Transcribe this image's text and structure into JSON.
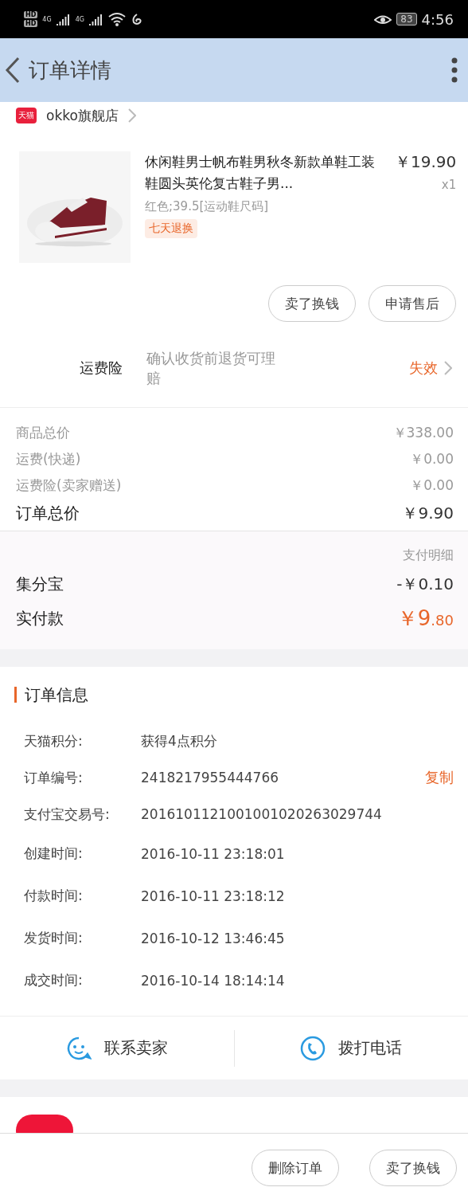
{
  "status_bar": {
    "sim_labels": [
      "HD",
      "HD"
    ],
    "network": [
      "4G",
      "4G"
    ],
    "battery": "83",
    "time": "4:56"
  },
  "header": {
    "title": "订单详情"
  },
  "store": {
    "badge": "天猫",
    "name": "okko旗舰店"
  },
  "product": {
    "kind": "picture",
    "title": "休闲鞋男士帆布鞋男秋冬新款单鞋工装鞋圆头英伦复古鞋子男...",
    "price": "￥19.90",
    "quantity": "x1",
    "spec": "红色;39.5[运动鞋尺码]",
    "tag": "七天退换"
  },
  "item_buttons": [
    "卖了换钱",
    "申请售后"
  ],
  "insurance": {
    "label": "运费险",
    "description": "确认收货前退货可理赔",
    "status": "失效"
  },
  "price_lines": [
    {
      "label": "商品总价",
      "value": "￥338.00",
      "kind": "minor"
    },
    {
      "label": "运费(快递)",
      "value": "￥0.00",
      "kind": "minor"
    },
    {
      "label": "运费险(卖家赠送)",
      "value": "￥0.00",
      "kind": "minor"
    },
    {
      "label": "订单总价",
      "value": "￥9.90",
      "kind": "major"
    }
  ],
  "payment": {
    "detail_link": "支付明细",
    "lines": [
      {
        "label": "集分宝",
        "value": "-￥0.10",
        "kind": "discount"
      },
      {
        "label": "实付款",
        "value_main": "￥9",
        "value_cents": ".80",
        "kind": "total"
      }
    ]
  },
  "order_info": {
    "title": "订单信息",
    "rows": [
      {
        "label": "天猫积分:",
        "value": "获得4点积分"
      },
      {
        "label": "订单编号:",
        "value": "2418217955444766",
        "action": "复制"
      },
      {
        "label": "支付宝交易号:",
        "value": "2016101121001001020263029744"
      },
      {
        "label": "创建时间:",
        "value": "2016-10-11 23:18:01"
      },
      {
        "label": "付款时间:",
        "value": "2016-10-11 23:18:12"
      },
      {
        "label": "发货时间:",
        "value": "2016-10-12 13:46:45"
      },
      {
        "label": "成交时间:",
        "value": "2016-10-14 18:14:14"
      }
    ]
  },
  "contact": [
    {
      "label": "联系卖家",
      "kind": "chat"
    },
    {
      "label": "拨打电话",
      "kind": "phone"
    }
  ],
  "bottom_buttons": [
    "删除订单",
    "卖了换钱"
  ]
}
